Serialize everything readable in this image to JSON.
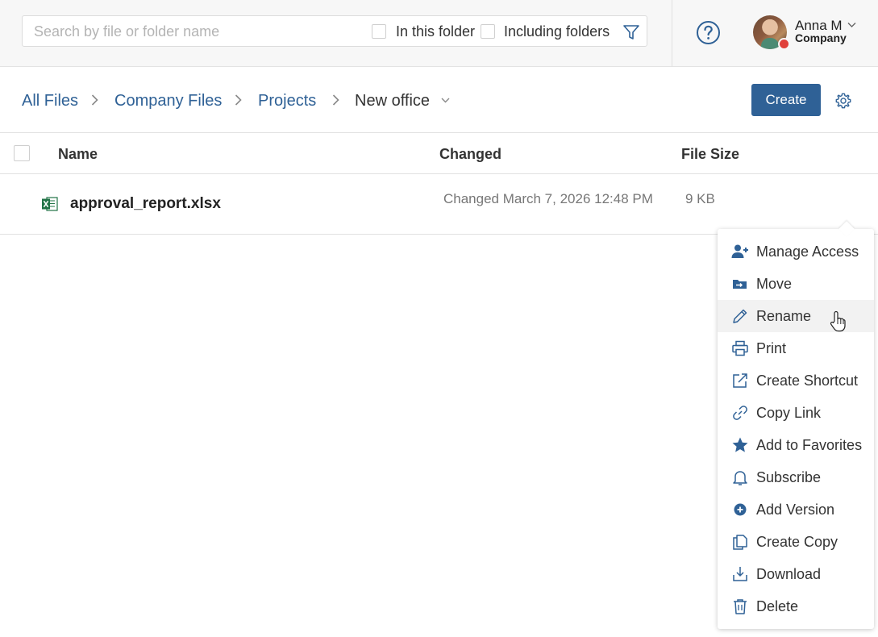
{
  "search": {
    "placeholder": "Search by file or folder name",
    "in_this_folder": "In this folder",
    "including_folders": "Including folders"
  },
  "user": {
    "name": "Anna M",
    "company": "Company"
  },
  "breadcrumb": [
    "All Files",
    "Company Files",
    "Projects",
    "New office"
  ],
  "toolbar": {
    "create_label": "Create"
  },
  "table": {
    "columns": [
      "Name",
      "Changed",
      "File Size"
    ],
    "rows": [
      {
        "name": "approval_report.xlsx",
        "changed": "Changed March 7, 2026 12:48 PM",
        "size": "9 KB"
      }
    ]
  },
  "context_menu": {
    "items": [
      {
        "label": "Manage Access",
        "icon": "user-add-icon"
      },
      {
        "label": "Move",
        "icon": "folder-move-icon"
      },
      {
        "label": "Rename",
        "icon": "pencil-icon"
      },
      {
        "label": "Print",
        "icon": "printer-icon"
      },
      {
        "label": "Create Shortcut",
        "icon": "external-link-icon"
      },
      {
        "label": "Copy Link",
        "icon": "link-icon"
      },
      {
        "label": "Add to Favorites",
        "icon": "star-icon"
      },
      {
        "label": "Subscribe",
        "icon": "bell-icon"
      },
      {
        "label": "Add Version",
        "icon": "plus-circle-icon"
      },
      {
        "label": "Create Copy",
        "icon": "copy-icon"
      },
      {
        "label": "Download",
        "icon": "download-icon"
      },
      {
        "label": "Delete",
        "icon": "trash-icon"
      }
    ]
  },
  "colors": {
    "accent": "#2f6196",
    "status_busy": "#e0413b",
    "excel_green": "#217346"
  }
}
